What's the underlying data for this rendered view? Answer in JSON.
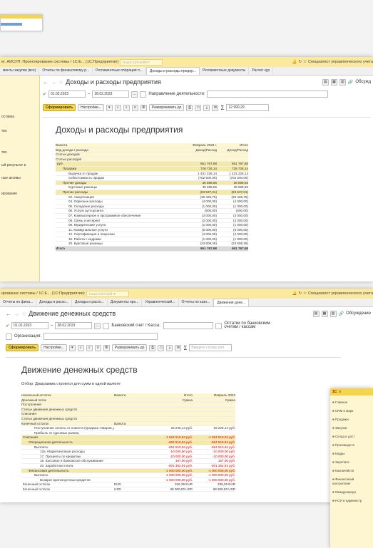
{
  "win1": {
    "title": "ег. АИСУП: Проектирование системы / 1С:Е... (1С:Предприятие)",
    "search_placeholder": "Поиск Ctrl+Shift+F",
    "user": "Специалист управленческого учета",
    "tabs": [
      "менты закупки (все)",
      "Отчеты по финансовому р...",
      "Регламентные операции п...",
      "Доходы и расходы предпр...",
      "Регламентные документы",
      "Расчет кур"
    ],
    "sidebar": [
      "оставка",
      "тво",
      "тво",
      "ый результат и",
      "ные активы",
      "ирование"
    ],
    "form_title": "Доходы и расходы предприятия",
    "date_from": "01.02.2023",
    "date_to": "28.02.2023",
    "direction_label": "Направление деятельности:",
    "discuss": "Обсужд",
    "btn_generate": "Сформировать",
    "btn_settings": "Настройки...",
    "btn_expand": "Разворачивать до",
    "sum": "12 990,29",
    "report_title": "Доходы и расходы предприятия",
    "hdr": [
      [
        "Валюта",
        "Февраль 2023 г.",
        "Итого"
      ],
      [
        "Вид дохода / расхода",
        "Доход/Расход",
        "Доход/Расход"
      ],
      [
        "Статьи доходов",
        "",
        ""
      ],
      [
        "Статьи расходов",
        "",
        ""
      ]
    ],
    "rows": [
      {
        "n": "руб.",
        "a": "661 767,68",
        "b": "661 767,68",
        "lvl": 0,
        "cls": "sumrow"
      },
      {
        "n": "Продажи",
        "a": "728 726,14",
        "b": "728 726,14",
        "lvl": 1,
        "cls": "sumrow"
      },
      {
        "n": "Выручка от продаж",
        "a": "1 431 226,14",
        "b": "1 431 226,14",
        "lvl": 2,
        "cls": ""
      },
      {
        "n": "Себестоимость продаж",
        "a": "(702 500,00)",
        "b": "(702 500,00)",
        "lvl": 2,
        "cls": ""
      },
      {
        "n": "Прочие доходы",
        "a": "36 598,55",
        "b": "36 598,55",
        "lvl": 1,
        "cls": "sumrow"
      },
      {
        "n": "Курсовые разницы",
        "a": "36 598,55",
        "b": "36 598,55",
        "lvl": 2,
        "cls": ""
      },
      {
        "n": "Прочие расходы",
        "a": "(83 537,01)",
        "b": "(83 537,01)",
        "lvl": 1,
        "cls": "sumrow"
      },
      {
        "n": "02. Амортизация",
        "a": "(36 428,75)",
        "b": "(36 428,75)",
        "lvl": 2,
        "cls": ""
      },
      {
        "n": "04. Офисные расходы",
        "a": "(4 000,00)",
        "b": "(4 000,00)",
        "lvl": 2,
        "cls": ""
      },
      {
        "n": "05. Складские расходы",
        "a": "(1 000,00)",
        "b": "(1 000,00)",
        "lvl": 2,
        "cls": ""
      },
      {
        "n": "06. Услуги аутсорсинга",
        "a": "(500,00)",
        "b": "(500,00)",
        "lvl": 2,
        "cls": ""
      },
      {
        "n": "07. Компьютерное и программное обеспечение",
        "a": "(3 000,00)",
        "b": "(3 000,00)",
        "lvl": 2,
        "cls": ""
      },
      {
        "n": "08. Связь и интернет",
        "a": "(2 000,00)",
        "b": "(2 000,00)",
        "lvl": 2,
        "cls": ""
      },
      {
        "n": "09. Юридические услуги",
        "a": "(1 000,00)",
        "b": "(1 000,00)",
        "lvl": 2,
        "cls": ""
      },
      {
        "n": "11. Коммунальные услуги",
        "a": "(5 000,00)",
        "b": "(5 000,00)",
        "lvl": 2,
        "cls": ""
      },
      {
        "n": "12. Сертификация и лицензии",
        "a": "(4 000,00)",
        "b": "(4 000,00)",
        "lvl": 2,
        "cls": ""
      },
      {
        "n": "15. Работа с кадрами",
        "a": "(1 000,00)",
        "b": "(1 000,00)",
        "lvl": 2,
        "cls": ""
      },
      {
        "n": "20. Курсовые разницы",
        "a": "(23 608,26)",
        "b": "(23 608,26)",
        "lvl": 2,
        "cls": ""
      }
    ],
    "total": [
      "Итого",
      "661 767,68",
      "661 767,68"
    ]
  },
  "win2": {
    "title": "ирование системы / 1С:Е... (1С:Предприятие)",
    "search_placeholder": "Поиск Ctrl+Shift+F",
    "user": "Специалист управленческого учета",
    "tabs": [
      "Отчеты по фина...",
      "Доходы и расхо...",
      "Доходы и расхо...",
      "Документы про...",
      "Управленческий...",
      "Отчеты по казн...",
      "Движения дене..."
    ],
    "form_title": "Движение денежных средств",
    "date_from": "01.02.2023",
    "date_to": "28.02.2023",
    "bank_label": "Банковский счет / Касса:",
    "balances_label": "Остатки по банковским счетам / кассам",
    "org_label": "Организация:",
    "discuss": "Обсуждение",
    "btn_generate": "Сформировать",
    "btn_settings": "Настройки...",
    "btn_expand": "Разворачивать до",
    "search_report": "Введите строку для",
    "report_title": "Движение денежных средств",
    "selection": "Отбор: Диаграмма строится для сумм в одной валюте",
    "hdr": [
      [
        "Начальный остаток",
        "Валюта",
        "Итого",
        "Февраль 2023"
      ],
      [
        "Денежный поток",
        "",
        "Сумма",
        "Сумма"
      ],
      [
        "Поступления",
        "",
        "",
        ""
      ],
      [
        "Статьи движения денежных средств",
        "",
        "",
        ""
      ],
      [
        "Списания",
        "",
        "",
        ""
      ],
      [
        "Статьи движения денежных средств",
        "",
        "",
        ""
      ],
      [
        "Конечный остаток",
        "Валюта",
        "",
        ""
      ]
    ],
    "rows": [
      {
        "n": "Поступление оплаты от клиента (продажа товаров, работ, услуг)",
        "a": "26 226,14 руб.",
        "b": "26 226,14 руб.",
        "lvl": 2,
        "red": false
      },
      {
        "n": "Прибыль от курсовых разниц",
        "a": "",
        "b": "",
        "lvl": 2,
        "red": false
      },
      {
        "n": "Списания",
        "a": "-1 664 519,94 руб.",
        "b": "-1 664 519,94 руб.",
        "lvl": 0,
        "red": true
      },
      {
        "n": "Операционная деятельность",
        "a": "-664 519,94 руб.",
        "b": "-664 519,94 руб.",
        "lvl": 1,
        "red": true
      },
      {
        "n": "Выплаты",
        "a": "-664 519,94 руб.",
        "b": "-664 519,94 руб.",
        "lvl": 2,
        "red": true
      },
      {
        "n": "13а. Маркетинговые расходы",
        "a": "-10 000,00 руб.",
        "b": "-10 000,00 руб.",
        "lvl": 3,
        "red": true
      },
      {
        "n": "17. Проценты по кредитам",
        "a": "-10 000,00 руб.",
        "b": "-10 000,00 руб.",
        "lvl": 3,
        "red": true
      },
      {
        "n": "18. Кассовое и банковское обслуживание",
        "a": "167,00 руб.",
        "b": "167,00 руб.",
        "lvl": 3,
        "red": true
      },
      {
        "n": "20. Заработная плата",
        "a": "-501 352,91 руб.",
        "b": "-501 352,91 руб.",
        "lvl": 3,
        "red": true
      },
      {
        "n": "Финансовая деятельность",
        "a": "-1 000 000,00 руб.",
        "b": "-1 000 000,00 руб.",
        "lvl": 1,
        "red": true
      },
      {
        "n": "Выплаты",
        "a": "-1 000 000,00 руб.",
        "b": "-1 000 000,00 руб.",
        "lvl": 2,
        "red": true
      },
      {
        "n": "Возврат краткосрочных кредитов",
        "a": "-1 000 000,00 руб.",
        "b": "-1 000 000,00 руб.",
        "lvl": 3,
        "red": true
      },
      {
        "n": "Конечный остаток",
        "c": "EUR",
        "a": "336,36 EUR",
        "b": "336,36 EUR",
        "lvl": 0,
        "red": false
      },
      {
        "n": "Конечный остаток",
        "c": "USD",
        "a": "68 900,00 USD",
        "b": "68 900,00 USD",
        "lvl": 0,
        "red": false
      }
    ]
  },
  "win3": {
    "sidebar": [
      "Главное",
      "CRM и марк",
      "Продажи",
      "Закупки",
      "Склад и дост",
      "Производств",
      "Кадры",
      "Зарплата",
      "Казначейств",
      "Финансовый контроллинг",
      "Международн",
      "НСИ и администр"
    ]
  }
}
